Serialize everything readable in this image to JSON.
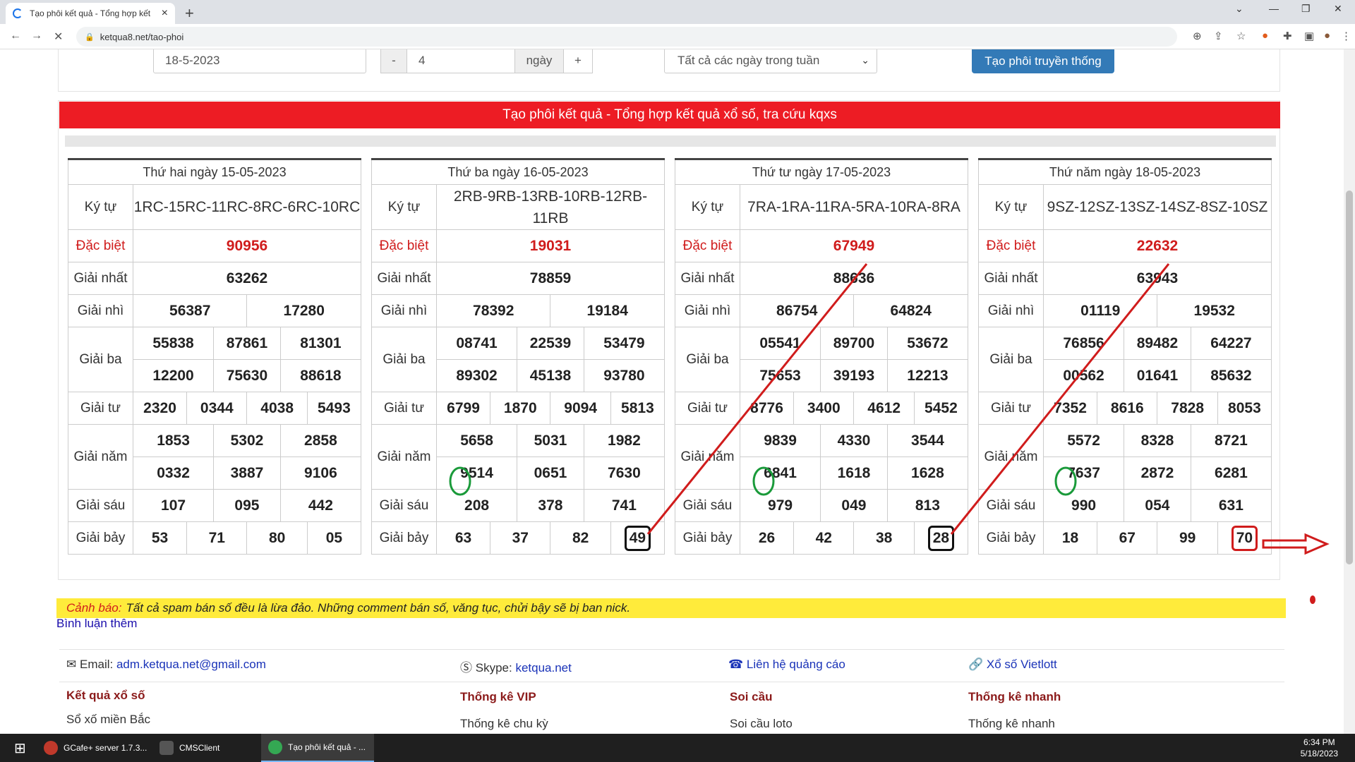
{
  "browser": {
    "tab_title": "Tạo phôi kết quả - Tổng hợp kết",
    "url": "ketqua8.net/tao-phoi"
  },
  "form": {
    "date": "18-5-2023",
    "minus": "-",
    "days": "4",
    "days_unit": "ngày",
    "plus": "+",
    "select": "Tất cả các ngày trong tuần",
    "button": "Tạo phôi truyền thống"
  },
  "banner": "Tạo phôi kết quả - Tổng hợp kết quả xổ số, tra cứu kqxs",
  "labels": {
    "ky_tu": "Ký tự",
    "db": "Đặc biệt",
    "g1": "Giải nhất",
    "g2": "Giải nhì",
    "g3": "Giải ba",
    "g4": "Giải tư",
    "g5": "Giải năm",
    "g6": "Giải sáu",
    "g7": "Giải bảy"
  },
  "results": [
    {
      "day": "Thứ hai ngày 15-05-2023",
      "ky_tu": "1RC-15RC-11RC-8RC-6RC-10RC",
      "db": "90956",
      "g1": "63262",
      "g2": [
        "56387",
        "17280"
      ],
      "g3": [
        "55838",
        "87861",
        "81301",
        "12200",
        "75630",
        "88618"
      ],
      "g4": [
        "2320",
        "0344",
        "4038",
        "5493"
      ],
      "g5": [
        "1853",
        "5302",
        "2858",
        "0332",
        "3887",
        "9106"
      ],
      "g6": [
        "107",
        "095",
        "442"
      ],
      "g7": [
        "53",
        "71",
        "80",
        "05"
      ]
    },
    {
      "day": "Thứ ba ngày 16-05-2023",
      "ky_tu": "2RB-9RB-13RB-10RB-12RB-11RB",
      "db": "19031",
      "g1": "78859",
      "g2": [
        "78392",
        "19184"
      ],
      "g3": [
        "08741",
        "22539",
        "53479",
        "89302",
        "45138",
        "93780"
      ],
      "g4": [
        "6799",
        "1870",
        "9094",
        "5813"
      ],
      "g5": [
        "5658",
        "5031",
        "1982",
        "9514",
        "0651",
        "7630"
      ],
      "g6": [
        "208",
        "378",
        "741"
      ],
      "g7": [
        "63",
        "37",
        "82",
        "49"
      ]
    },
    {
      "day": "Thứ tư ngày 17-05-2023",
      "ky_tu": "7RA-1RA-11RA-5RA-10RA-8RA",
      "db": "67949",
      "g1": "88636",
      "g2": [
        "86754",
        "64824"
      ],
      "g3": [
        "05541",
        "89700",
        "53672",
        "75653",
        "39193",
        "12213"
      ],
      "g4": [
        "8776",
        "3400",
        "4612",
        "5452"
      ],
      "g5": [
        "9839",
        "4330",
        "3544",
        "6841",
        "1618",
        "1628"
      ],
      "g6": [
        "979",
        "049",
        "813"
      ],
      "g7": [
        "26",
        "42",
        "38",
        "28"
      ]
    },
    {
      "day": "Thứ năm ngày 18-05-2023",
      "ky_tu": "9SZ-12SZ-13SZ-14SZ-8SZ-10SZ",
      "db": "22632",
      "g1": "63943",
      "g2": [
        "01119",
        "19532"
      ],
      "g3": [
        "76856",
        "89482",
        "64227",
        "00562",
        "01641",
        "85632"
      ],
      "g4": [
        "7352",
        "8616",
        "7828",
        "8053"
      ],
      "g5": [
        "5572",
        "8328",
        "8721",
        "7637",
        "2872",
        "6281"
      ],
      "g6": [
        "990",
        "054",
        "631"
      ],
      "g7": [
        "18",
        "67",
        "99",
        "70"
      ]
    }
  ],
  "warning": {
    "prefix": "Cảnh báo:",
    "text": "Tất cả spam bán số đều là lừa đảo. Những comment bán số, văng tục, chửi bậy sẽ bị ban nick."
  },
  "comment_link": "Bình luận thêm",
  "footer": {
    "email_label": "Email:",
    "email": "adm.ketqua.net@gmail.com",
    "skype_label": "Skype:",
    "skype": "ketqua.net",
    "ads": "Liên hệ quảng cáo",
    "vietlott": "Xổ số Vietlott",
    "cols": [
      {
        "h": "Kết quả xổ số",
        "l": "Sổ xố miền Bắc"
      },
      {
        "h": "Thống kê VIP",
        "l": "Thống kê chu kỳ"
      },
      {
        "h": "Soi cầu",
        "l": "Soi cầu loto"
      },
      {
        "h": "Thống kê nhanh",
        "l": "Thống kê nhanh"
      }
    ]
  },
  "taskbar": {
    "items": [
      "GCafe+ server 1.7.3...",
      "CMSClient",
      "Tạo phôi kết quả - ..."
    ],
    "time": "6:34 PM",
    "date": "5/18/2023"
  }
}
